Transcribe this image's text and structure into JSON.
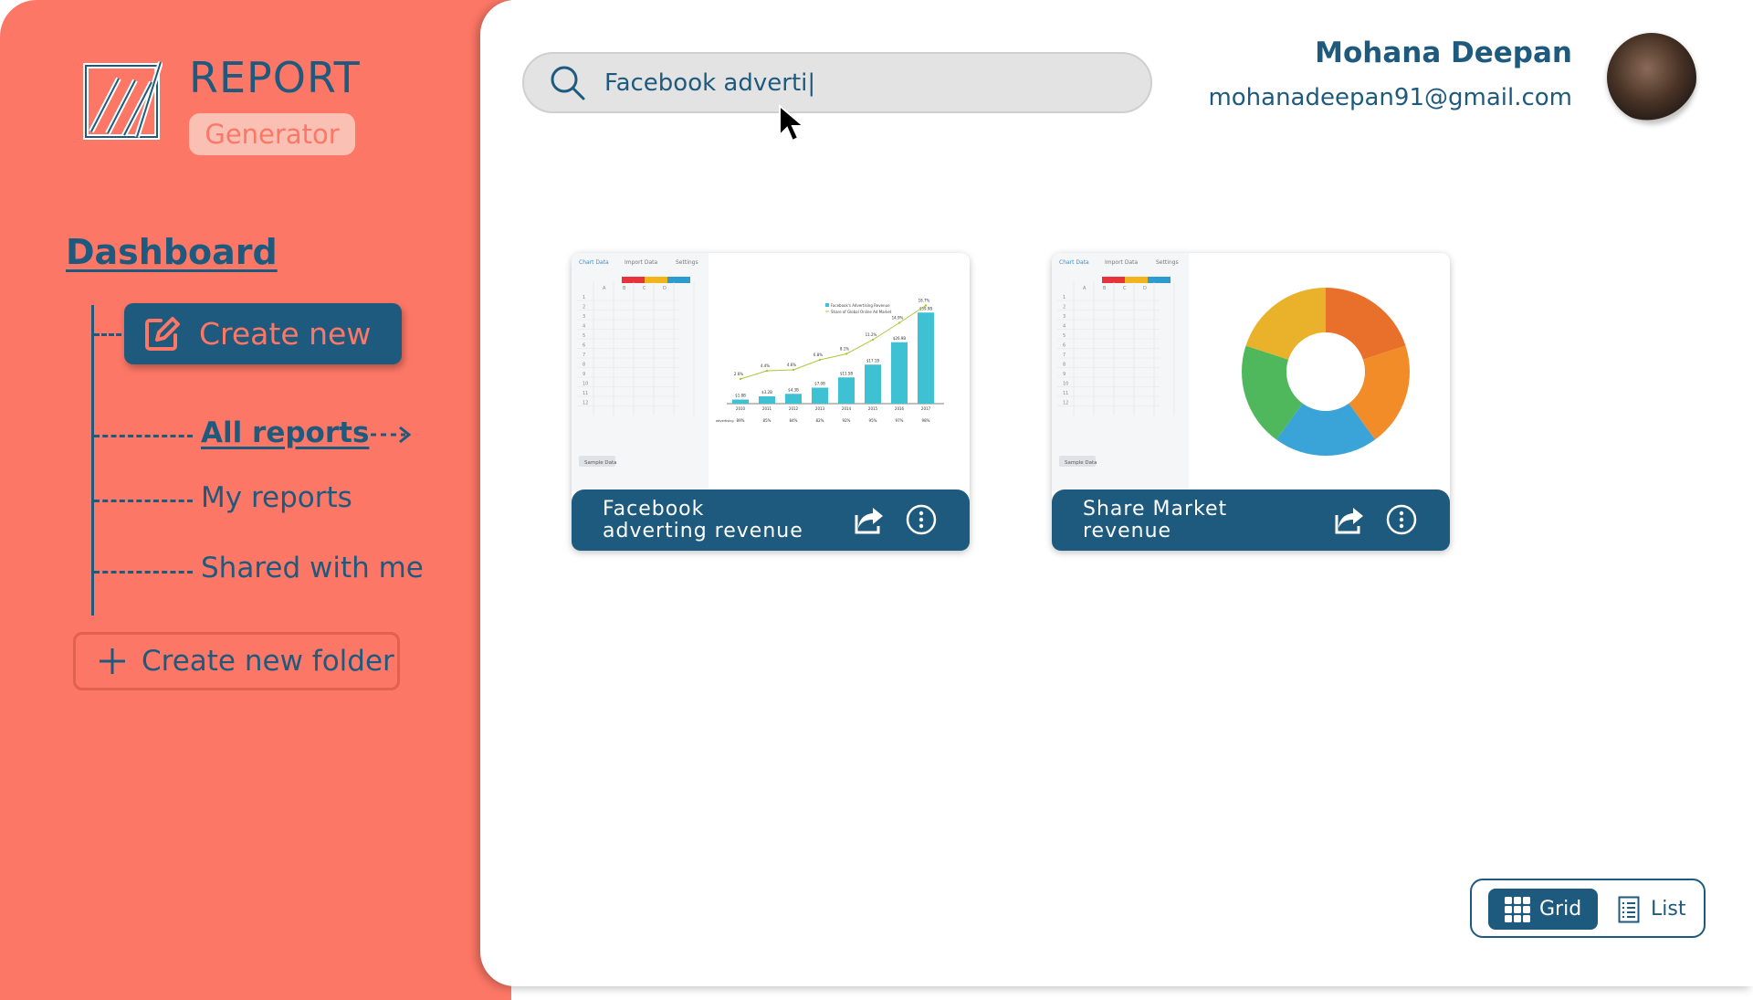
{
  "app": {
    "logo_title": "REPORT",
    "logo_subtitle": "Generator"
  },
  "sidebar": {
    "section_title": "Dashboard",
    "create_new_label": "Create new",
    "items": [
      {
        "label": "All reports",
        "active": true
      },
      {
        "label": "My reports",
        "active": false
      },
      {
        "label": "Shared with me",
        "active": false
      }
    ],
    "create_folder_label": "Create new folder"
  },
  "search": {
    "value": "Facebook adverti|",
    "placeholder": "Search"
  },
  "user": {
    "name": "Mohana Deepan",
    "email": "mohanadeepan91@gmail.com"
  },
  "reports": [
    {
      "title": "Facebook adverting revenue",
      "preview": "bar-line-chart"
    },
    {
      "title": "Share Market revenue",
      "preview": "donut-chart"
    }
  ],
  "preview_editor": {
    "tabs": [
      "Chart Data",
      "Import Data",
      "Settings"
    ],
    "columns": [
      "A",
      "B",
      "C",
      "D"
    ],
    "rows": [
      "1",
      "2",
      "3",
      "4",
      "5",
      "6",
      "7",
      "8",
      "9",
      "10",
      "11",
      "12"
    ],
    "sample_button": "Sample Data"
  },
  "facebook_chart": {
    "categories": [
      "2010",
      "2011",
      "2012",
      "2013",
      "2014",
      "2015",
      "2016",
      "2017"
    ],
    "bar_labels": [
      "$1.8B",
      "$3.2B",
      "$4.3B",
      "$7.0B",
      "$11.5B",
      "$17.1B",
      "$26.9B",
      "$39.9B"
    ],
    "line_labels": [
      "2.6%",
      "4.4%",
      "4.6%",
      "6.8%",
      "8.1%",
      "11.2%",
      "14.9%",
      "18.7%"
    ],
    "values": [
      1.8,
      3.2,
      4.3,
      7.0,
      11.5,
      17.1,
      26.9,
      39.9
    ],
    "share": [
      2.6,
      4.4,
      4.6,
      6.8,
      8.1,
      11.2,
      14.9,
      18.7
    ],
    "legend": [
      "Facebook's Advertising Revenue",
      "Share of Global Online Ad Market"
    ],
    "row_label": "advertising",
    "row_values": [
      "89%",
      "85%",
      "84%",
      "82%",
      "92%",
      "95%",
      "97%",
      "98%"
    ],
    "bar_color": "#3ec1d3",
    "line_color": "#a8c93a"
  },
  "donut_chart": {
    "values": [
      20,
      20,
      20,
      20,
      20
    ],
    "colors": [
      "#e8702a",
      "#f28c28",
      "#3aa3d8",
      "#50b85c",
      "#eab12a"
    ]
  },
  "view_toggle": {
    "grid_label": "Grid",
    "list_label": "List",
    "active": "Grid"
  },
  "colors": {
    "sidebar": "#fd7766",
    "primary": "#1e5a7e",
    "search_bg": "#e3e3e3"
  }
}
